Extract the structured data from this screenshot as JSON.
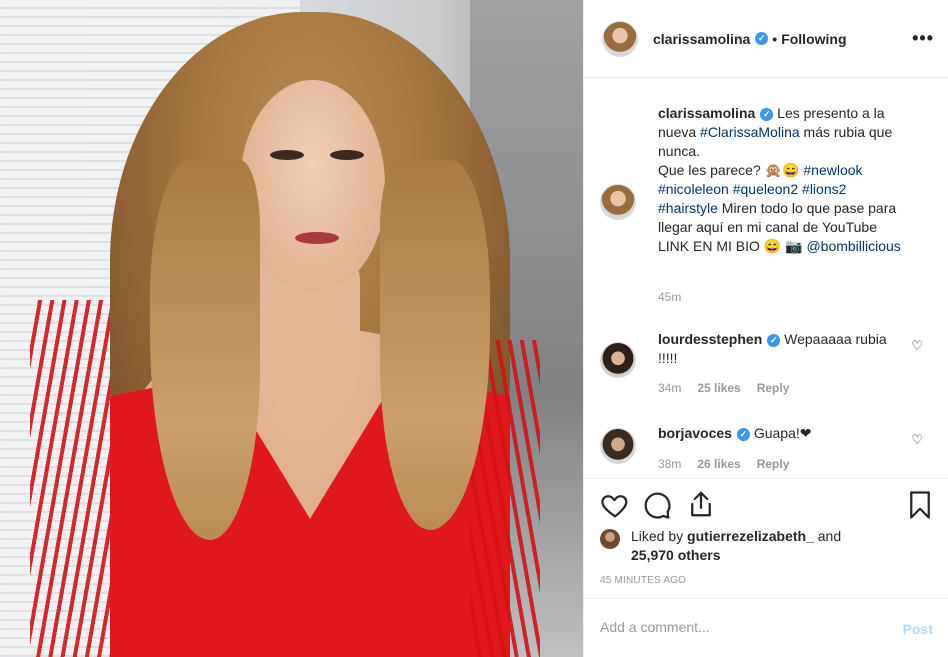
{
  "header": {
    "username": "clarissamolina",
    "separator": "•",
    "follow_status": "Following",
    "more": "•••"
  },
  "caption": {
    "username": "clarissamolina",
    "text_1": " Les presento a la nueva ",
    "tag_1": "#ClarissaMolina",
    "text_2": " más rubia que nunca.",
    "text_3": "Que les parece? 🙊😄 ",
    "tag_2": "#newlook",
    "tag_3": "#nicoleleon",
    "tag_4": "#queleon2",
    "tag_5": "#lions2",
    "tag_6": "#hairstyle",
    "text_4": " Miren todo lo que pase para llegar aquí en mi canal de YouTube LINK EN MI BIO 😄 📷 ",
    "mention": "@bombillicious",
    "time": "45m"
  },
  "comments": [
    {
      "username": "lourdesstephen",
      "text": " Wepaaaaa rubia !!!!!",
      "time": "34m",
      "likes": "25 likes",
      "reply": "Reply"
    },
    {
      "username": "borjavoces",
      "text": " Guapa!❤",
      "time": "38m",
      "likes": "26 likes",
      "reply": "Reply"
    }
  ],
  "likes": {
    "prefix": "Liked by ",
    "user": "gutierrezelizabeth_",
    "and": " and",
    "others": "25,970 others"
  },
  "timestamp": "45 MINUTES AGO",
  "add_comment": {
    "placeholder": "Add a comment...",
    "post_label": "Post"
  },
  "icons": [
    "heart-icon",
    "comment-icon",
    "share-icon",
    "bookmark-icon",
    "verified-icon",
    "more-options-icon"
  ],
  "colors": {
    "link": "#003569",
    "verified": "#3897f0",
    "post_disabled": "#b3dbff"
  }
}
